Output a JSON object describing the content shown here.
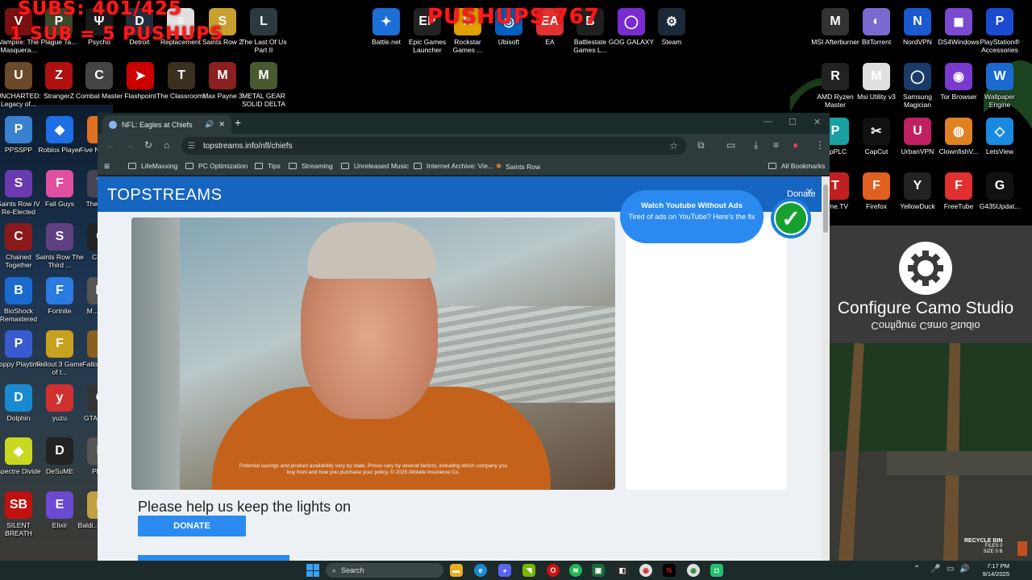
{
  "overlays": {
    "subs": "SUBS: 401/425",
    "sub_rule": "1 SUB = 5 PUSHUPS",
    "pushups": "PUSHUPS 767"
  },
  "desktop_icons": {
    "top_row": [
      {
        "label": "Vampire: The Masquera...",
        "color": "#7a1010",
        "glyph": "V"
      },
      {
        "label": "Plague Ta...",
        "color": "#3b4a2a",
        "glyph": "P"
      },
      {
        "label": "Psycho",
        "color": "#1a1a1a",
        "glyph": "Ψ"
      },
      {
        "label": "Detroit",
        "color": "#203040",
        "glyph": "D"
      },
      {
        "label": "Replacement",
        "color": "#e0e0e0",
        "glyph": "≡"
      },
      {
        "label": "Saints Row 2",
        "color": "#c8a030",
        "glyph": "S"
      },
      {
        "label": "The Last Of Us Part II",
        "color": "#2c3a3f",
        "glyph": "L"
      },
      {
        "label": "Battle.net",
        "color": "#1d6fd8",
        "glyph": "✦"
      },
      {
        "label": "Epic Games Launcher",
        "color": "#222",
        "glyph": "EP"
      },
      {
        "label": "Rockstar Games ...",
        "color": "#e0a000",
        "glyph": "R"
      },
      {
        "label": "Ubisoft",
        "color": "#0060c0",
        "glyph": "◎"
      },
      {
        "label": "EA",
        "color": "#e03030",
        "glyph": "EA"
      },
      {
        "label": "Battlestate Games L...",
        "color": "#202020",
        "glyph": "B"
      },
      {
        "label": "GOG GALAXY",
        "color": "#7a2bd0",
        "glyph": "◯"
      },
      {
        "label": "Steam",
        "color": "#1b2838",
        "glyph": "⚙"
      }
    ],
    "row2": [
      {
        "label": "UNCHARTED: Legacy of...",
        "color": "#6a4a2a",
        "glyph": "U"
      },
      {
        "label": "StrangerZ",
        "color": "#b01010",
        "glyph": "Z"
      },
      {
        "label": "Combat Master",
        "color": "#444",
        "glyph": "C"
      },
      {
        "label": "Flashpoint",
        "color": "#c00",
        "glyph": "➤"
      },
      {
        "label": "The Classrooms",
        "color": "#3a3020",
        "glyph": "T"
      },
      {
        "label": "Max Payne 3",
        "color": "#8a2020",
        "glyph": "M"
      },
      {
        "label": "METAL GEAR SOLID DELTA",
        "color": "#4a5a30",
        "glyph": "M"
      }
    ],
    "left_col": [
      {
        "label": "PPSSPP",
        "color": "#3a80d0",
        "glyph": "P"
      },
      {
        "label": "Roblox Player",
        "color": "#1e6ee6",
        "glyph": "◆"
      },
      {
        "label": "Five N... Re...",
        "color": "#e07020",
        "glyph": "F"
      },
      {
        "label": "Saints Row IV Re-Elected",
        "color": "#6a3ab0",
        "glyph": "S"
      },
      {
        "label": "Fall Guys",
        "color": "#e050a0",
        "glyph": "F"
      },
      {
        "label": "The ... Us",
        "color": "#445",
        "glyph": "T"
      },
      {
        "label": "Chained Together",
        "color": "#8a1a1a",
        "glyph": "C"
      },
      {
        "label": "Saints Row The Third ...",
        "color": "#604080",
        "glyph": "S"
      },
      {
        "label": "Call...",
        "color": "#222",
        "glyph": "C"
      },
      {
        "label": "BioShock Remastered",
        "color": "#1a6ad0",
        "glyph": "B"
      },
      {
        "label": "Fortnite",
        "color": "#2a7ae0",
        "glyph": "F"
      },
      {
        "label": "M... De...",
        "color": "#555",
        "glyph": "M"
      },
      {
        "label": "Poppy Playtime",
        "color": "#3a5ad0",
        "glyph": "P"
      },
      {
        "label": "Fallout 3 Game of t...",
        "color": "#c8a020",
        "glyph": "F"
      },
      {
        "label": "Fallo... Ve...",
        "color": "#886020",
        "glyph": "F"
      },
      {
        "label": "Dolphin",
        "color": "#1a8ad0",
        "glyph": "D"
      },
      {
        "label": "yuzu",
        "color": "#d03030",
        "glyph": "y"
      },
      {
        "label": "GTA Trilo...",
        "color": "#333",
        "glyph": "G"
      },
      {
        "label": "Spectre Divide",
        "color": "#c8d820",
        "glyph": "◆"
      },
      {
        "label": "DeSuME",
        "color": "#222",
        "glyph": "D"
      },
      {
        "label": "Plut...",
        "color": "#555",
        "glyph": "P"
      },
      {
        "label": "SILENT BREATH",
        "color": "#c01010",
        "glyph": "SB"
      },
      {
        "label": "Elixir",
        "color": "#6a4ad0",
        "glyph": "E"
      },
      {
        "label": "Baldi... Class...",
        "color": "#c0a040",
        "glyph": "B"
      }
    ],
    "right_col": [
      {
        "label": "MSI Afterburner",
        "color": "#333",
        "glyph": "M"
      },
      {
        "label": "BitTorrent",
        "color": "#7a6ad0",
        "glyph": "◐"
      },
      {
        "label": "NordVPN",
        "color": "#1a5ad0",
        "glyph": "N"
      },
      {
        "label": "DS4Windows",
        "color": "#7a4ad0",
        "glyph": "◼"
      },
      {
        "label": "PlayStation® Accessories",
        "color": "#1a4ad0",
        "glyph": "P"
      },
      {
        "label": "AMD Ryzen Master",
        "color": "#222",
        "glyph": "R"
      },
      {
        "label": "Msi Utility v3",
        "color": "#e0e0e0",
        "glyph": "M"
      },
      {
        "label": "Samsung Magician",
        "color": "#1a3a6a",
        "glyph": "◯"
      },
      {
        "label": "Tor Browser",
        "color": "#7a3ad0",
        "glyph": "◉"
      },
      {
        "label": "Wallpaper Engine",
        "color": "#1a6ad0",
        "glyph": "W"
      },
      {
        "label": "...pPLC",
        "color": "#1aa0a0",
        "glyph": "P"
      },
      {
        "label": "CapCut",
        "color": "#111",
        "glyph": "✂"
      },
      {
        "label": "UrbanVPN",
        "color": "#c02060",
        "glyph": "U"
      },
      {
        "label": "ClownfishV...",
        "color": "#e08020",
        "glyph": "◍"
      },
      {
        "label": "LetsView",
        "color": "#1a8ae0",
        "glyph": "◇"
      },
      {
        "label": "...me.TV",
        "color": "#c02020",
        "glyph": "T"
      },
      {
        "label": "Firefox",
        "color": "#e06020",
        "glyph": "F"
      },
      {
        "label": "YellowDuck",
        "color": "#222",
        "glyph": "Y"
      },
      {
        "label": "FreeTube",
        "color": "#e03030",
        "glyph": "F"
      },
      {
        "label": "G435Updat...",
        "color": "#111",
        "glyph": "G"
      }
    ]
  },
  "camo": {
    "title": "Configure Camo Studio",
    "mirror": "Configure Camo Studio"
  },
  "browser": {
    "tab_title": "NFL: Eagles at Chiefs",
    "url": "topstreams.info/nfl/chiefs",
    "bookmarks": [
      "LifeMaxxing",
      "PC Optimization",
      "Tips",
      "Streaming",
      "Unreleased Music",
      "Internet Archive: Vie...",
      "Saints Row"
    ],
    "all_bookmarks": "All Bookmarks"
  },
  "page": {
    "site_title": "TOPSTREAMS",
    "donate_link": "Donate",
    "popup_title": "Watch Youtube Without Ads",
    "popup_sub": "Tired of ads on YouTube? Here's the fix",
    "video_caption": "Potential savings and product availability vary by state. Prices vary by several factors, including which company you buy from and how you purchase your policy. © 2025 Allstate Insurance Co.",
    "help_text": "Please help us keep the lights on",
    "donate_button": "DONATE"
  },
  "taskbar": {
    "search_placeholder": "Search",
    "time": "7:17 PM",
    "date": "9/14/2025",
    "recycle_title": "RECYCLE BIN",
    "recycle_files": "FILES 0",
    "recycle_size": "SIZE 0 B"
  }
}
